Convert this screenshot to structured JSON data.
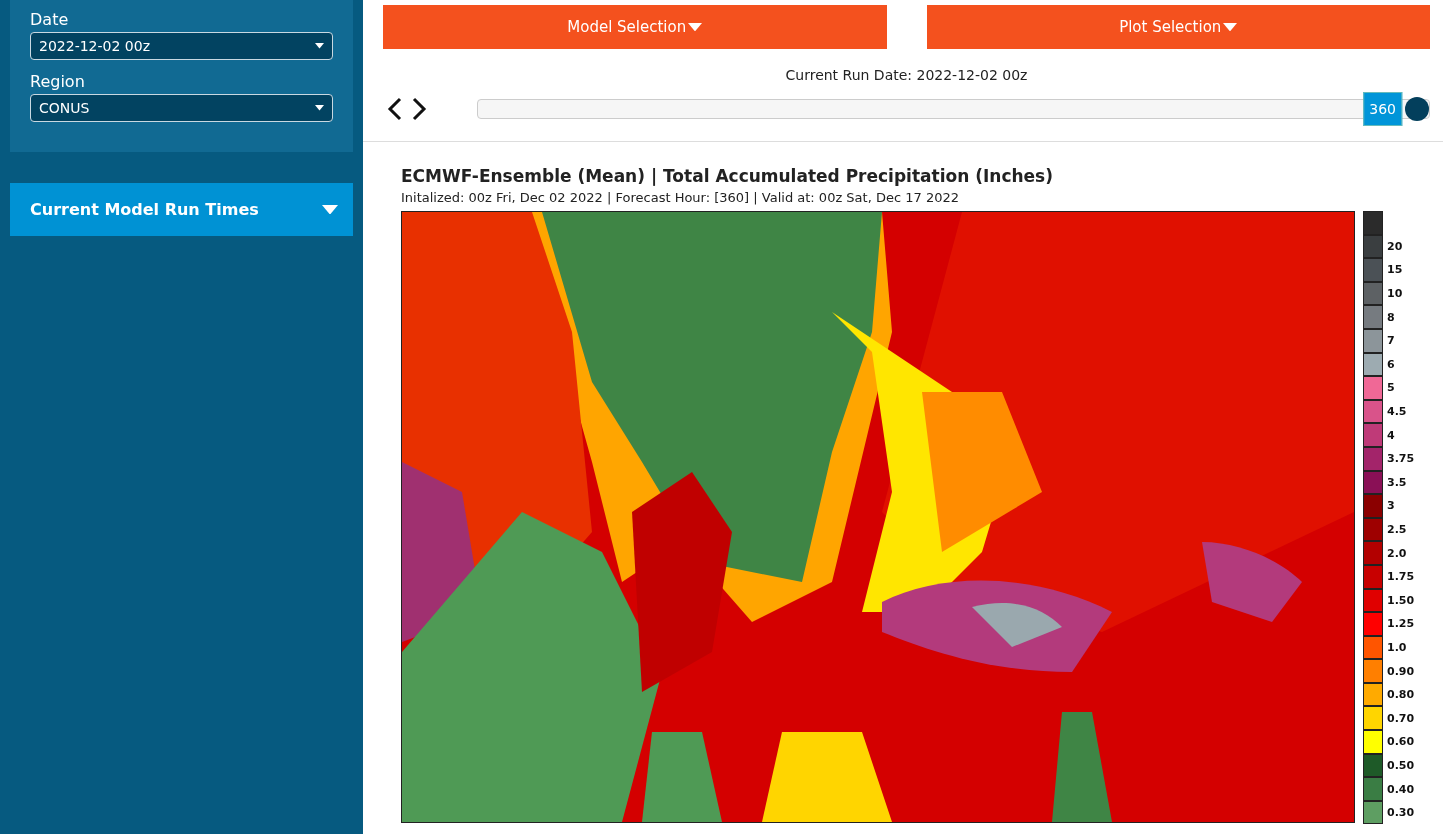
{
  "sidebar": {
    "fields": [
      {
        "label": "Date",
        "value": "2022-12-02 00z"
      },
      {
        "label": "Region",
        "value": "CONUS"
      }
    ],
    "accordion": {
      "label": "Current Model Run Times",
      "expanded": false
    }
  },
  "menus": [
    {
      "label": "Model Selection"
    },
    {
      "label": "Plot Selection"
    }
  ],
  "run_date": "Current Run Date: 2022-12-02 00z",
  "slider": {
    "level": 1,
    "value": "360"
  },
  "plot": {
    "title": "ECMWF-Ensemble (Mean)  |  Total Accumulated Precipitation (Inches)",
    "subtitle": "Initalized: 00z Fri, Dec 02 2022  |  Forecast Hour: [360]  |  Valid at: 00z Sat, Dec 17 2022",
    "legend_cap": {
      "color": "#2b2b2b"
    },
    "legend": [
      {
        "label": "20",
        "color": "#3a3e40"
      },
      {
        "label": "15",
        "color": "#4b5156"
      },
      {
        "label": "10",
        "color": "#5d6164"
      },
      {
        "label": "8",
        "color": "#767b80"
      },
      {
        "label": "7",
        "color": "#8c959a"
      },
      {
        "label": "6",
        "color": "#9dabb1"
      },
      {
        "label": "5",
        "color": "#f06896"
      },
      {
        "label": "4.5",
        "color": "#d9538a"
      },
      {
        "label": "4",
        "color": "#bf3a78"
      },
      {
        "label": "3.75",
        "color": "#a3246a"
      },
      {
        "label": "3.5",
        "color": "#8a1056"
      },
      {
        "label": "3",
        "color": "#8b0000"
      },
      {
        "label": "2.5",
        "color": "#9e0000"
      },
      {
        "label": "2.0",
        "color": "#b20000"
      },
      {
        "label": "1.75",
        "color": "#c80000"
      },
      {
        "label": "1.50",
        "color": "#e00000"
      },
      {
        "label": "1.25",
        "color": "#ff0000"
      },
      {
        "label": "1.0",
        "color": "#ff5500"
      },
      {
        "label": "0.90",
        "color": "#ff7f00"
      },
      {
        "label": "0.80",
        "color": "#ffaa00"
      },
      {
        "label": "0.70",
        "color": "#ffd500"
      },
      {
        "label": "0.60",
        "color": "#ffff00"
      },
      {
        "label": "0.50",
        "color": "#1e5a28"
      },
      {
        "label": "0.40",
        "color": "#3a7d44"
      },
      {
        "label": "0.30",
        "color": "#5e9e62"
      }
    ]
  }
}
